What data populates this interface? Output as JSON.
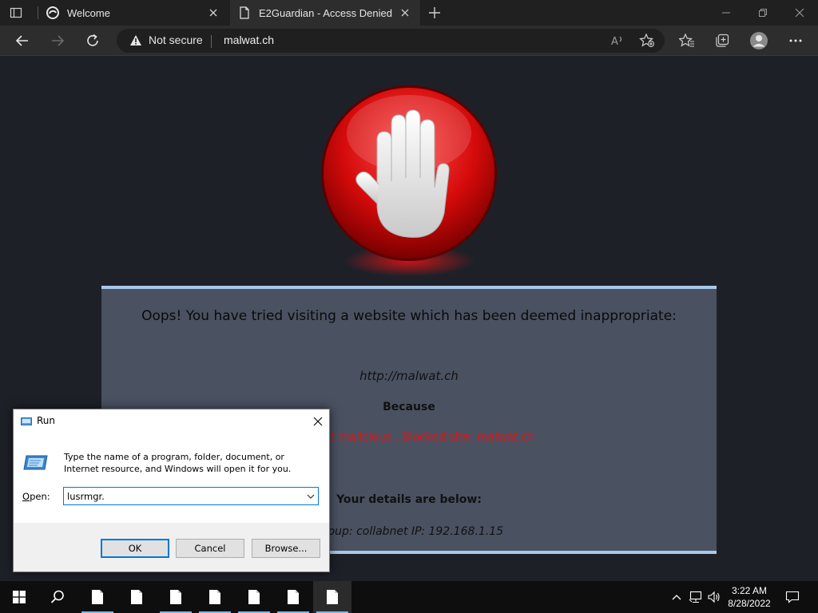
{
  "browser": {
    "tabs": [
      {
        "label": "Welcome"
      },
      {
        "label": "E2Guardian - Access Denied"
      }
    ],
    "security_label": "Not secure",
    "url": "malwat.ch"
  },
  "blockpage": {
    "heading": "Oops! You have tried visiting a website which has been deemed inappropriate:",
    "blocked_url": "http://malwat.ch",
    "because_label": "Because",
    "reason": "collabnet malicious . Blocked site: malwat.ch",
    "details_heading": "Your details are below:",
    "details_line": "Group: collabnet   IP: 192.168.1.15"
  },
  "run_dialog": {
    "title": "Run",
    "description": "Type the name of a program, folder, document, or Internet resource, and Windows will open it for you.",
    "open_label_prefix": "",
    "open_label_accel": "O",
    "open_label_suffix": "pen:",
    "input_value": "lusrmgr.",
    "ok_label": "OK",
    "cancel_label": "Cancel",
    "browse_label": "Browse..."
  },
  "taskbar": {
    "time": "3:22 AM",
    "date": "8/28/2022",
    "file_items": [
      {
        "name": "file-1"
      },
      {
        "name": "file-2"
      },
      {
        "name": "file-3"
      },
      {
        "name": "file-4"
      },
      {
        "name": "file-5"
      },
      {
        "name": "file-6"
      },
      {
        "name": "file-7"
      }
    ]
  },
  "colors": {
    "page_bg": "#1e2028",
    "card_bg": "#4a5161",
    "card_border": "#a8c8e8",
    "reason_red": "#e81010",
    "accent_blue": "#0078d7"
  }
}
